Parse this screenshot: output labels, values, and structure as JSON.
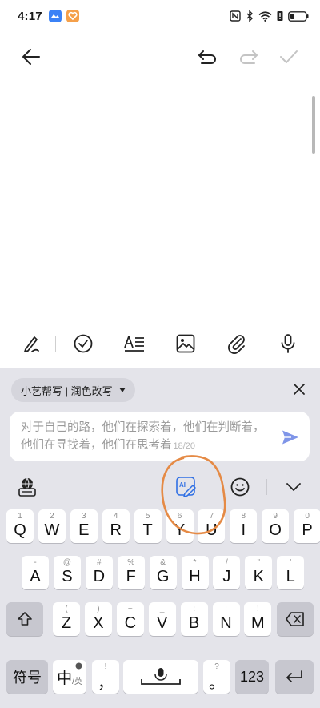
{
  "status_bar": {
    "time": "4:17",
    "app_icons": [
      "cloud-app-icon",
      "heart-app-icon"
    ],
    "indicators": [
      "nfc-icon",
      "bluetooth-icon",
      "wifi-icon",
      "battery-alert-icon",
      "battery-icon"
    ]
  },
  "toolbar": {
    "back_icon": "arrow-left-icon",
    "undo_icon": "undo-icon",
    "redo_icon": "redo-icon",
    "confirm_icon": "checkmark-icon"
  },
  "edit_toolbar": {
    "icons": [
      "handwriting-icon",
      "checklist-icon",
      "text-style-icon",
      "image-icon",
      "attachment-icon",
      "microphone-icon"
    ]
  },
  "ai_assistant": {
    "mode_label": "小艺帮写 | 润色改写",
    "input_text": "对于自己的路，他们在探索着，他们在判断着，他们在寻找着，他们在思考着",
    "char_count": "18/20"
  },
  "keyboard_tools": {
    "ai_label": "AI"
  },
  "keyboard": {
    "row1": [
      {
        "main": "Q",
        "hint": "1"
      },
      {
        "main": "W",
        "hint": "2"
      },
      {
        "main": "E",
        "hint": "3"
      },
      {
        "main": "R",
        "hint": "4"
      },
      {
        "main": "T",
        "hint": "5"
      },
      {
        "main": "Y",
        "hint": "6"
      },
      {
        "main": "U",
        "hint": "7"
      },
      {
        "main": "I",
        "hint": "8"
      },
      {
        "main": "O",
        "hint": "9"
      },
      {
        "main": "P",
        "hint": "0"
      }
    ],
    "row2": [
      {
        "main": "A",
        "hint": "-"
      },
      {
        "main": "S",
        "hint": "@"
      },
      {
        "main": "D",
        "hint": "#"
      },
      {
        "main": "F",
        "hint": "%"
      },
      {
        "main": "G",
        "hint": "&"
      },
      {
        "main": "H",
        "hint": "*"
      },
      {
        "main": "J",
        "hint": "/"
      },
      {
        "main": "K",
        "hint": "\""
      },
      {
        "main": "L",
        "hint": "'"
      }
    ],
    "row3": [
      {
        "main": "Z",
        "hint": "("
      },
      {
        "main": "X",
        "hint": ")"
      },
      {
        "main": "C",
        "hint": "~"
      },
      {
        "main": "V",
        "hint": "_"
      },
      {
        "main": "B",
        "hint": ":"
      },
      {
        "main": "N",
        "hint": ";"
      },
      {
        "main": "M",
        "hint": "!"
      }
    ],
    "symbol_key": "符号",
    "lang_key_main": "中",
    "lang_key_sub": "英",
    "comma_key": "，",
    "comma_hint": "!",
    "period_key": "。",
    "period_hint": "?",
    "num_key": "123"
  },
  "colors": {
    "accent": "#2f6fe4",
    "send_icon": "#7f95e8",
    "annotation_stroke": "#e58a45",
    "keyboard_bg": "#e4e4ea"
  }
}
